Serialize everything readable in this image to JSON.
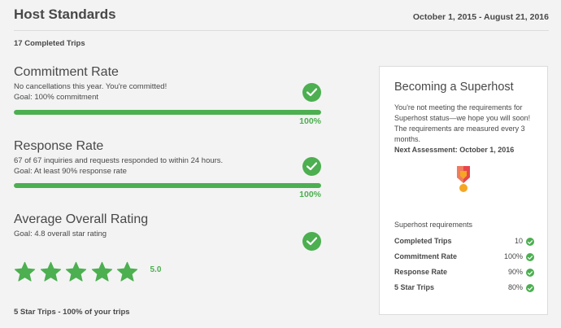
{
  "header": {
    "title": "Host Standards",
    "date_range": "October 1, 2015 - August 21, 2016"
  },
  "completed_trips": "17 Completed Trips",
  "metrics": [
    {
      "title": "Commitment Rate",
      "line1": "No cancellations this year. You're committed!",
      "line2": "Goal: 100% commitment",
      "percent_label": "100%",
      "fill_fraction": 1.0
    },
    {
      "title": "Response Rate",
      "line1": "67 of 67 inquiries and requests responded to within 24 hours.",
      "line2": "Goal: At least 90% response rate",
      "percent_label": "100%",
      "fill_fraction": 1.0
    },
    {
      "title": "Average Overall Rating",
      "line1": "Goal: 4.8 overall star rating",
      "rating_value": "5.0",
      "stars_filled": 5
    }
  ],
  "five_star_trips": "5 Star Trips - 100% of your trips",
  "panel": {
    "title": "Becoming a Superhost",
    "text": "You're not meeting the requirements for Superhost status—we hope you will soon! The requirements are measured every 3 months.",
    "next_assessment": "Next Assessment: October 1, 2016",
    "requirements_title": "Superhost requirements",
    "requirements": [
      {
        "label": "Completed Trips",
        "value": "10"
      },
      {
        "label": "Commitment Rate",
        "value": "100%"
      },
      {
        "label": "Response Rate",
        "value": "90%"
      },
      {
        "label": "5 Star Trips",
        "value": "80%"
      }
    ]
  },
  "colors": {
    "accent_green": "#4caf50",
    "text": "#484848",
    "background": "#f3f3f3",
    "medal_red": "#e8464b",
    "medal_orange": "#f5a623"
  },
  "icons": {
    "check": "check-circle-icon",
    "star": "star-icon",
    "medal": "superhost-medal-icon"
  }
}
